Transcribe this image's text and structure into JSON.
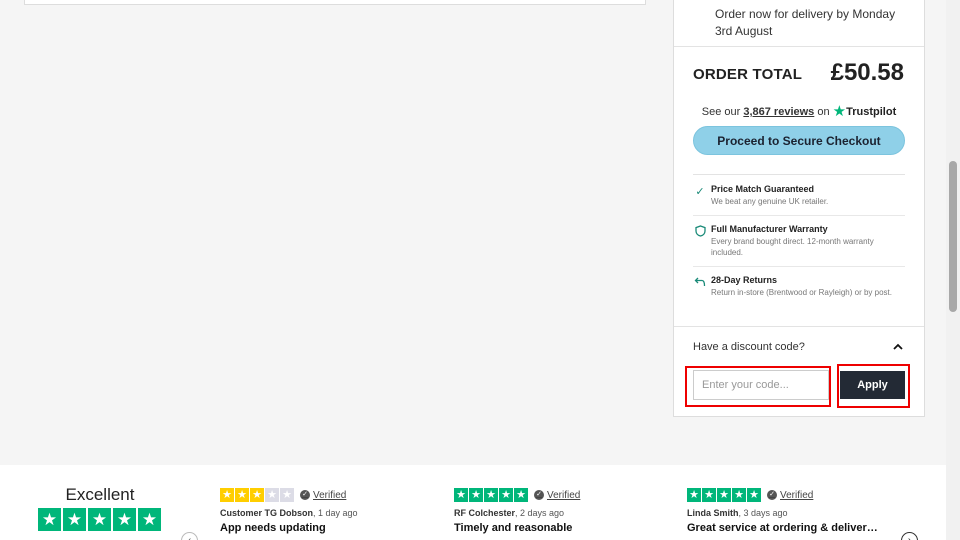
{
  "summary": {
    "delivery_text": "Order now for delivery by Monday 3rd August",
    "order_total_label": "ORDER TOTAL",
    "order_total_value": "£50.58",
    "trust_prefix": "See our",
    "trust_count": "3,867 reviews",
    "trust_on": "on",
    "trust_brand": "Trustpilot",
    "checkout_label": "Proceed to Secure Checkout",
    "features": [
      {
        "title": "Price Match Guaranteed",
        "desc": "We beat any genuine UK retailer.",
        "icon": "check-icon"
      },
      {
        "title": "Full Manufacturer Warranty",
        "desc": "Every brand bought direct. 12-month warranty included.",
        "icon": "shield-icon"
      },
      {
        "title": "28-Day Returns",
        "desc": "Return in-store (Brentwood or Rayleigh) or by post.",
        "icon": "return-arrow-icon"
      }
    ],
    "discount_label": "Have a discount code?",
    "discount_placeholder": "Enter your code...",
    "apply_label": "Apply"
  },
  "reviews": {
    "rating_word": "Excellent",
    "items": [
      {
        "rating": 3,
        "verified": "Verified",
        "author": "Customer TG Dobson",
        "age": "1 day ago",
        "title": "App needs updating"
      },
      {
        "rating": 5,
        "verified": "Verified",
        "author": "RF Colchester",
        "age": "2 days ago",
        "title": "Timely and reasonable"
      },
      {
        "rating": 5,
        "verified": "Verified",
        "author": "Linda Smith",
        "age": "3 days ago",
        "title": "Great service at ordering & delivery…"
      }
    ]
  },
  "colors": {
    "trustpilot_green": "#00b67a",
    "three_star_yellow": "#ffce00",
    "checkout_button": "#8fd0e8",
    "apply_button": "#232a35",
    "highlight_red": "#e00000"
  }
}
